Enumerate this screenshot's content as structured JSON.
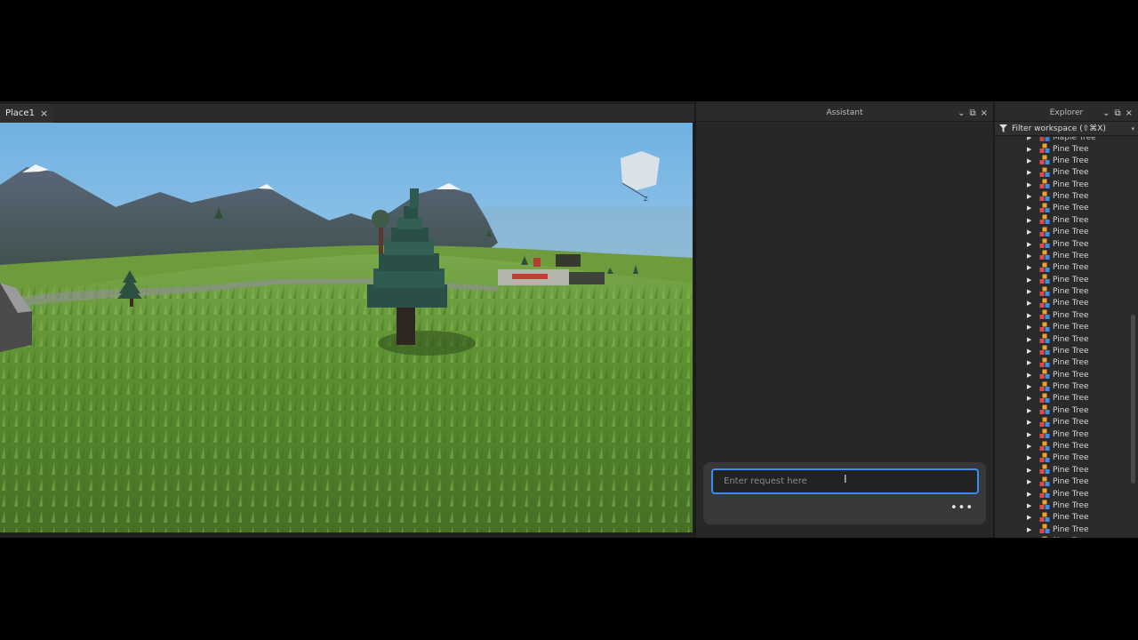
{
  "viewport": {
    "tab_label": "Place1",
    "tab_close": "×"
  },
  "assistant": {
    "title": "Assistant",
    "input_placeholder": "Enter request here",
    "more_label": "•••",
    "controls": {
      "collapse": "⌄",
      "popout": "⧉",
      "close": "×"
    }
  },
  "explorer": {
    "title": "Explorer",
    "filter_placeholder": "Filter workspace (⇧⌘X)",
    "controls": {
      "collapse": "⌄",
      "popout": "⧉",
      "close": "×"
    },
    "partial_top_label": "Maple Tree",
    "items": [
      "Pine Tree",
      "Pine Tree",
      "Pine Tree",
      "Pine Tree",
      "Pine Tree",
      "Pine Tree",
      "Pine Tree",
      "Pine Tree",
      "Pine Tree",
      "Pine Tree",
      "Pine Tree",
      "Pine Tree",
      "Pine Tree",
      "Pine Tree",
      "Pine Tree",
      "Pine Tree",
      "Pine Tree",
      "Pine Tree",
      "Pine Tree",
      "Pine Tree",
      "Pine Tree",
      "Pine Tree",
      "Pine Tree",
      "Pine Tree",
      "Pine Tree",
      "Pine Tree",
      "Pine Tree",
      "Pine Tree",
      "Pine Tree",
      "Pine Tree",
      "Pine Tree",
      "Pine Tree",
      "Pine Tree"
    ],
    "partial_bottom_label": "Pine Tree"
  },
  "colors": {
    "accent": "#3b8cf2",
    "sky": "#9fcbe6",
    "grass": "#5e8f2f"
  }
}
